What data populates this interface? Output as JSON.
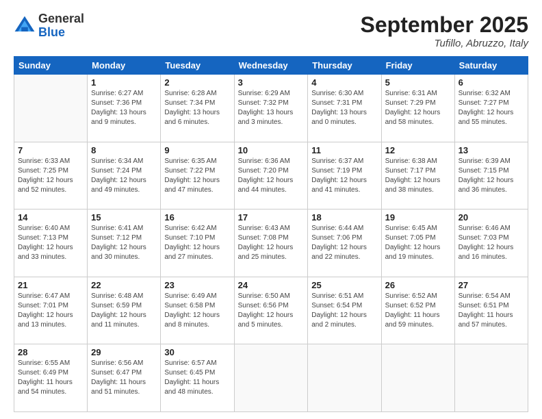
{
  "header": {
    "logo": {
      "general": "General",
      "blue": "Blue"
    },
    "title": "September 2025",
    "location": "Tufillo, Abruzzo, Italy"
  },
  "calendar": {
    "days_of_week": [
      "Sunday",
      "Monday",
      "Tuesday",
      "Wednesday",
      "Thursday",
      "Friday",
      "Saturday"
    ],
    "weeks": [
      [
        {
          "day": "",
          "info": ""
        },
        {
          "day": "1",
          "info": "Sunrise: 6:27 AM\nSunset: 7:36 PM\nDaylight: 13 hours\nand 9 minutes."
        },
        {
          "day": "2",
          "info": "Sunrise: 6:28 AM\nSunset: 7:34 PM\nDaylight: 13 hours\nand 6 minutes."
        },
        {
          "day": "3",
          "info": "Sunrise: 6:29 AM\nSunset: 7:32 PM\nDaylight: 13 hours\nand 3 minutes."
        },
        {
          "day": "4",
          "info": "Sunrise: 6:30 AM\nSunset: 7:31 PM\nDaylight: 13 hours\nand 0 minutes."
        },
        {
          "day": "5",
          "info": "Sunrise: 6:31 AM\nSunset: 7:29 PM\nDaylight: 12 hours\nand 58 minutes."
        },
        {
          "day": "6",
          "info": "Sunrise: 6:32 AM\nSunset: 7:27 PM\nDaylight: 12 hours\nand 55 minutes."
        }
      ],
      [
        {
          "day": "7",
          "info": "Sunrise: 6:33 AM\nSunset: 7:25 PM\nDaylight: 12 hours\nand 52 minutes."
        },
        {
          "day": "8",
          "info": "Sunrise: 6:34 AM\nSunset: 7:24 PM\nDaylight: 12 hours\nand 49 minutes."
        },
        {
          "day": "9",
          "info": "Sunrise: 6:35 AM\nSunset: 7:22 PM\nDaylight: 12 hours\nand 47 minutes."
        },
        {
          "day": "10",
          "info": "Sunrise: 6:36 AM\nSunset: 7:20 PM\nDaylight: 12 hours\nand 44 minutes."
        },
        {
          "day": "11",
          "info": "Sunrise: 6:37 AM\nSunset: 7:19 PM\nDaylight: 12 hours\nand 41 minutes."
        },
        {
          "day": "12",
          "info": "Sunrise: 6:38 AM\nSunset: 7:17 PM\nDaylight: 12 hours\nand 38 minutes."
        },
        {
          "day": "13",
          "info": "Sunrise: 6:39 AM\nSunset: 7:15 PM\nDaylight: 12 hours\nand 36 minutes."
        }
      ],
      [
        {
          "day": "14",
          "info": "Sunrise: 6:40 AM\nSunset: 7:13 PM\nDaylight: 12 hours\nand 33 minutes."
        },
        {
          "day": "15",
          "info": "Sunrise: 6:41 AM\nSunset: 7:12 PM\nDaylight: 12 hours\nand 30 minutes."
        },
        {
          "day": "16",
          "info": "Sunrise: 6:42 AM\nSunset: 7:10 PM\nDaylight: 12 hours\nand 27 minutes."
        },
        {
          "day": "17",
          "info": "Sunrise: 6:43 AM\nSunset: 7:08 PM\nDaylight: 12 hours\nand 25 minutes."
        },
        {
          "day": "18",
          "info": "Sunrise: 6:44 AM\nSunset: 7:06 PM\nDaylight: 12 hours\nand 22 minutes."
        },
        {
          "day": "19",
          "info": "Sunrise: 6:45 AM\nSunset: 7:05 PM\nDaylight: 12 hours\nand 19 minutes."
        },
        {
          "day": "20",
          "info": "Sunrise: 6:46 AM\nSunset: 7:03 PM\nDaylight: 12 hours\nand 16 minutes."
        }
      ],
      [
        {
          "day": "21",
          "info": "Sunrise: 6:47 AM\nSunset: 7:01 PM\nDaylight: 12 hours\nand 13 minutes."
        },
        {
          "day": "22",
          "info": "Sunrise: 6:48 AM\nSunset: 6:59 PM\nDaylight: 12 hours\nand 11 minutes."
        },
        {
          "day": "23",
          "info": "Sunrise: 6:49 AM\nSunset: 6:58 PM\nDaylight: 12 hours\nand 8 minutes."
        },
        {
          "day": "24",
          "info": "Sunrise: 6:50 AM\nSunset: 6:56 PM\nDaylight: 12 hours\nand 5 minutes."
        },
        {
          "day": "25",
          "info": "Sunrise: 6:51 AM\nSunset: 6:54 PM\nDaylight: 12 hours\nand 2 minutes."
        },
        {
          "day": "26",
          "info": "Sunrise: 6:52 AM\nSunset: 6:52 PM\nDaylight: 11 hours\nand 59 minutes."
        },
        {
          "day": "27",
          "info": "Sunrise: 6:54 AM\nSunset: 6:51 PM\nDaylight: 11 hours\nand 57 minutes."
        }
      ],
      [
        {
          "day": "28",
          "info": "Sunrise: 6:55 AM\nSunset: 6:49 PM\nDaylight: 11 hours\nand 54 minutes."
        },
        {
          "day": "29",
          "info": "Sunrise: 6:56 AM\nSunset: 6:47 PM\nDaylight: 11 hours\nand 51 minutes."
        },
        {
          "day": "30",
          "info": "Sunrise: 6:57 AM\nSunset: 6:45 PM\nDaylight: 11 hours\nand 48 minutes."
        },
        {
          "day": "",
          "info": ""
        },
        {
          "day": "",
          "info": ""
        },
        {
          "day": "",
          "info": ""
        },
        {
          "day": "",
          "info": ""
        }
      ]
    ]
  }
}
